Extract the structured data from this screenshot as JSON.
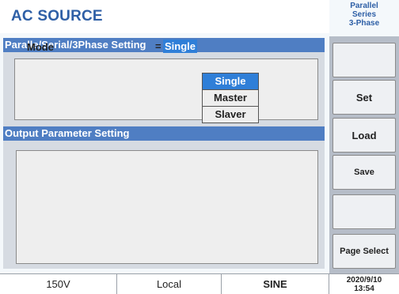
{
  "header": {
    "title": "AC SOURCE"
  },
  "mode_indicator": {
    "line1": "Parallel",
    "line2": "Series",
    "line3": "3-Phase"
  },
  "sections": {
    "parallel": {
      "title": "Paralle/Serial/3Phase  Setting"
    },
    "output": {
      "title": "Output Parameter Setting"
    }
  },
  "mode_setting": {
    "label": "Mode",
    "equals": "=",
    "value": "Single",
    "options": [
      "Single",
      "Master",
      "Slaver"
    ],
    "selected_index": 0
  },
  "soft_keys": [
    "",
    "Set",
    "Load",
    "Save",
    "",
    "Page Select"
  ],
  "status_bar": {
    "voltage_range": "150V",
    "control": "Local",
    "waveform": "SINE",
    "date": "2020/9/10",
    "time": "13:54"
  },
  "colors": {
    "title": "#2e5fa6",
    "section_header": "#4f7ec3",
    "highlight": "#2f7fd8",
    "side_panel": "#b6bdc8"
  }
}
